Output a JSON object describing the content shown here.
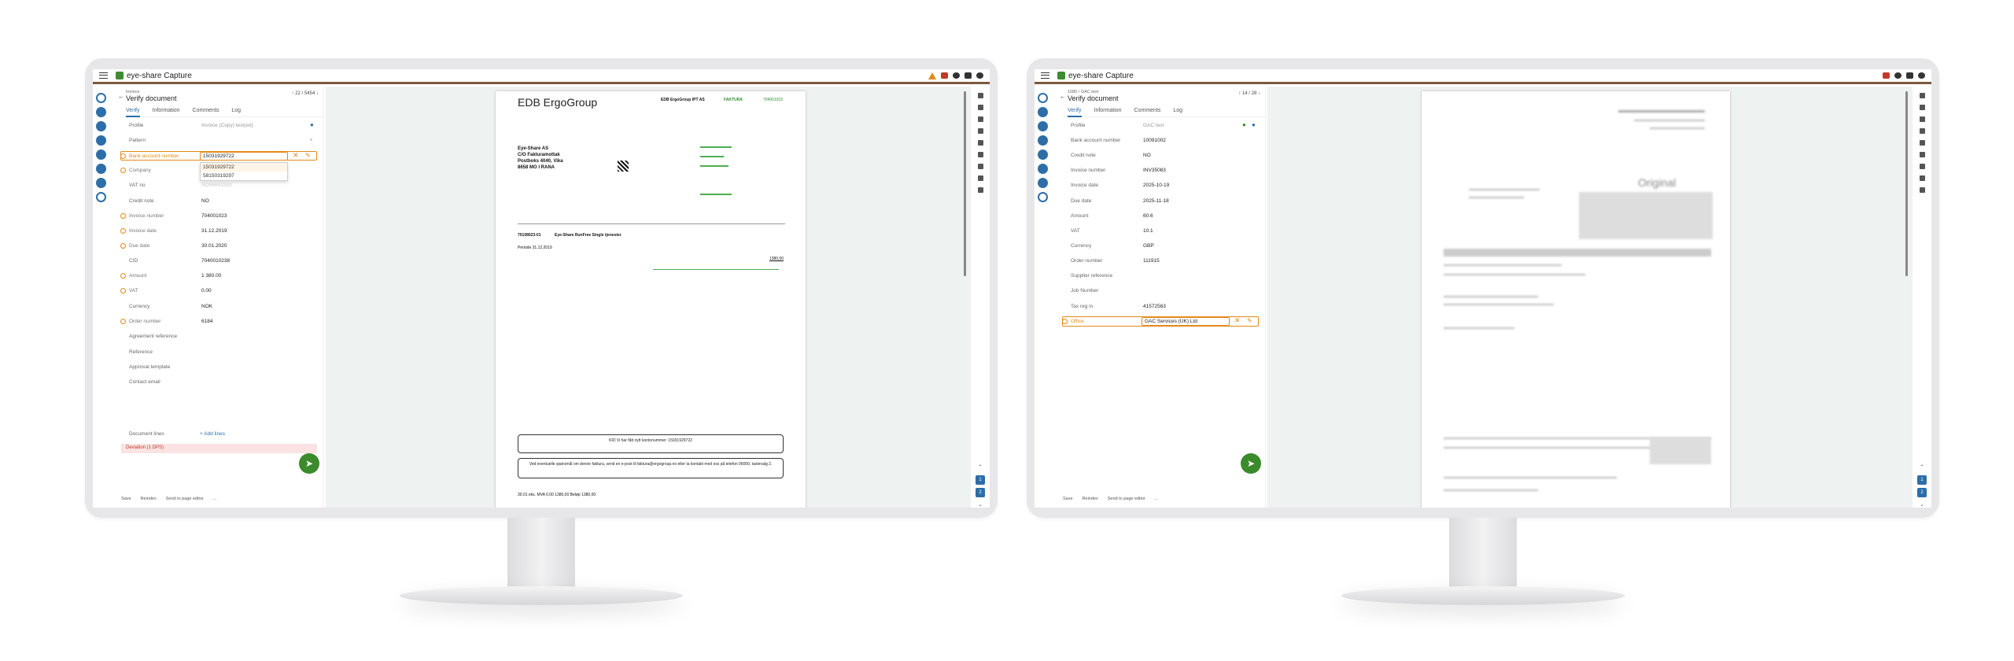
{
  "left": {
    "app_title": "eye-share Capture",
    "breadcrumb": "Invoice",
    "page_title": "Verify document",
    "pager": "22 / 5454",
    "tabs": [
      "Verify",
      "Information",
      "Comments",
      "Log"
    ],
    "fields": [
      {
        "label": "Profile",
        "value": "Invoice (Copy) test(ed)"
      },
      {
        "label": "Pattern",
        "value": ""
      },
      {
        "label": "Bank account number",
        "value": "15031929722"
      },
      {
        "label": "Company",
        "value": ""
      },
      {
        "label": "VAT no",
        "value": "NO96843383"
      },
      {
        "label": "Credit note",
        "value": "NO"
      },
      {
        "label": "Invoice number",
        "value": "704001023"
      },
      {
        "label": "Invoice date",
        "value": "31.12.2019"
      },
      {
        "label": "Due date",
        "value": "30.01.2020"
      },
      {
        "label": "CID",
        "value": "7040010238"
      },
      {
        "label": "Amount",
        "value": "1 380.00"
      },
      {
        "label": "VAT",
        "value": "0.00"
      },
      {
        "label": "Currency",
        "value": "NOK"
      },
      {
        "label": "Order number",
        "value": "6184"
      },
      {
        "label": "Agreement reference",
        "value": ""
      },
      {
        "label": "Reference",
        "value": ""
      },
      {
        "label": "Approval template",
        "value": ""
      },
      {
        "label": "Contact email",
        "value": ""
      }
    ],
    "dropdown_options": [
      "15031929722",
      "58150319297"
    ],
    "document_lines_label": "Document lines",
    "add_lines": "+ Add lines",
    "deviation": "Deviation (1 DPS)",
    "footer": [
      "Save",
      "Reindex",
      "Send to page editor",
      "..."
    ],
    "pages": [
      "1",
      "2"
    ],
    "doc": {
      "brand": "EDB ErgoGroup",
      "company_header": "EDB ErgoGroup IPT AS",
      "factura": "FAKTURA",
      "invoice_no": "704001023",
      "addr1": "Eye-Share AS",
      "addr2": "C/O Fakturamottak",
      "addr3": "Postboks 4040, Vika",
      "addr4": "8658 MO I RANA",
      "item_no": "70108023-01",
      "item_desc": "Eye-Share RunFree Single tjenester",
      "period": "Periode 31.12.2019",
      "sum": "1380,00",
      "box1": "KID Vi har fått nytt kontonummer: 15031929722",
      "box2": "Ved eventuelle spørsmål om denne faktura, send en e-post til faktura@ergogroup.no eller ta kontakt med oss på telefon 06000, tastevalg 2.",
      "bottom": "30.01 eks. MVA  0,00  1380,00  Beløp  1380,00"
    }
  },
  "right": {
    "app_title": "eye-share Capture",
    "breadcrumb": "1080 / GAC test",
    "page_title": "Verify document",
    "pager": "14 / 28",
    "tabs": [
      "Verify",
      "Information",
      "Comments",
      "Log"
    ],
    "fields": [
      {
        "label": "Profile",
        "value": "GAC test"
      },
      {
        "label": "Bank account number",
        "value": "10091002"
      },
      {
        "label": "Credit note",
        "value": "NO"
      },
      {
        "label": "Invoice number",
        "value": "INV35083"
      },
      {
        "label": "Invoice date",
        "value": "2025-10-19"
      },
      {
        "label": "Due date",
        "value": "2025-11-18"
      },
      {
        "label": "Amount",
        "value": "60.6"
      },
      {
        "label": "VAT",
        "value": "10.1"
      },
      {
        "label": "Currency",
        "value": "GBP"
      },
      {
        "label": "Order number",
        "value": "111915"
      },
      {
        "label": "Supplier reference",
        "value": ""
      },
      {
        "label": "Job Number",
        "value": ""
      },
      {
        "label": "Tax reg in",
        "value": "41572563"
      },
      {
        "label": "Office",
        "value": "GAC Services (UK) Ltd"
      }
    ],
    "footer": [
      "Save",
      "Reindex",
      "Send to page editor",
      "..."
    ],
    "pages": [
      "1",
      "2"
    ],
    "doc": {
      "heading": "Original"
    }
  }
}
